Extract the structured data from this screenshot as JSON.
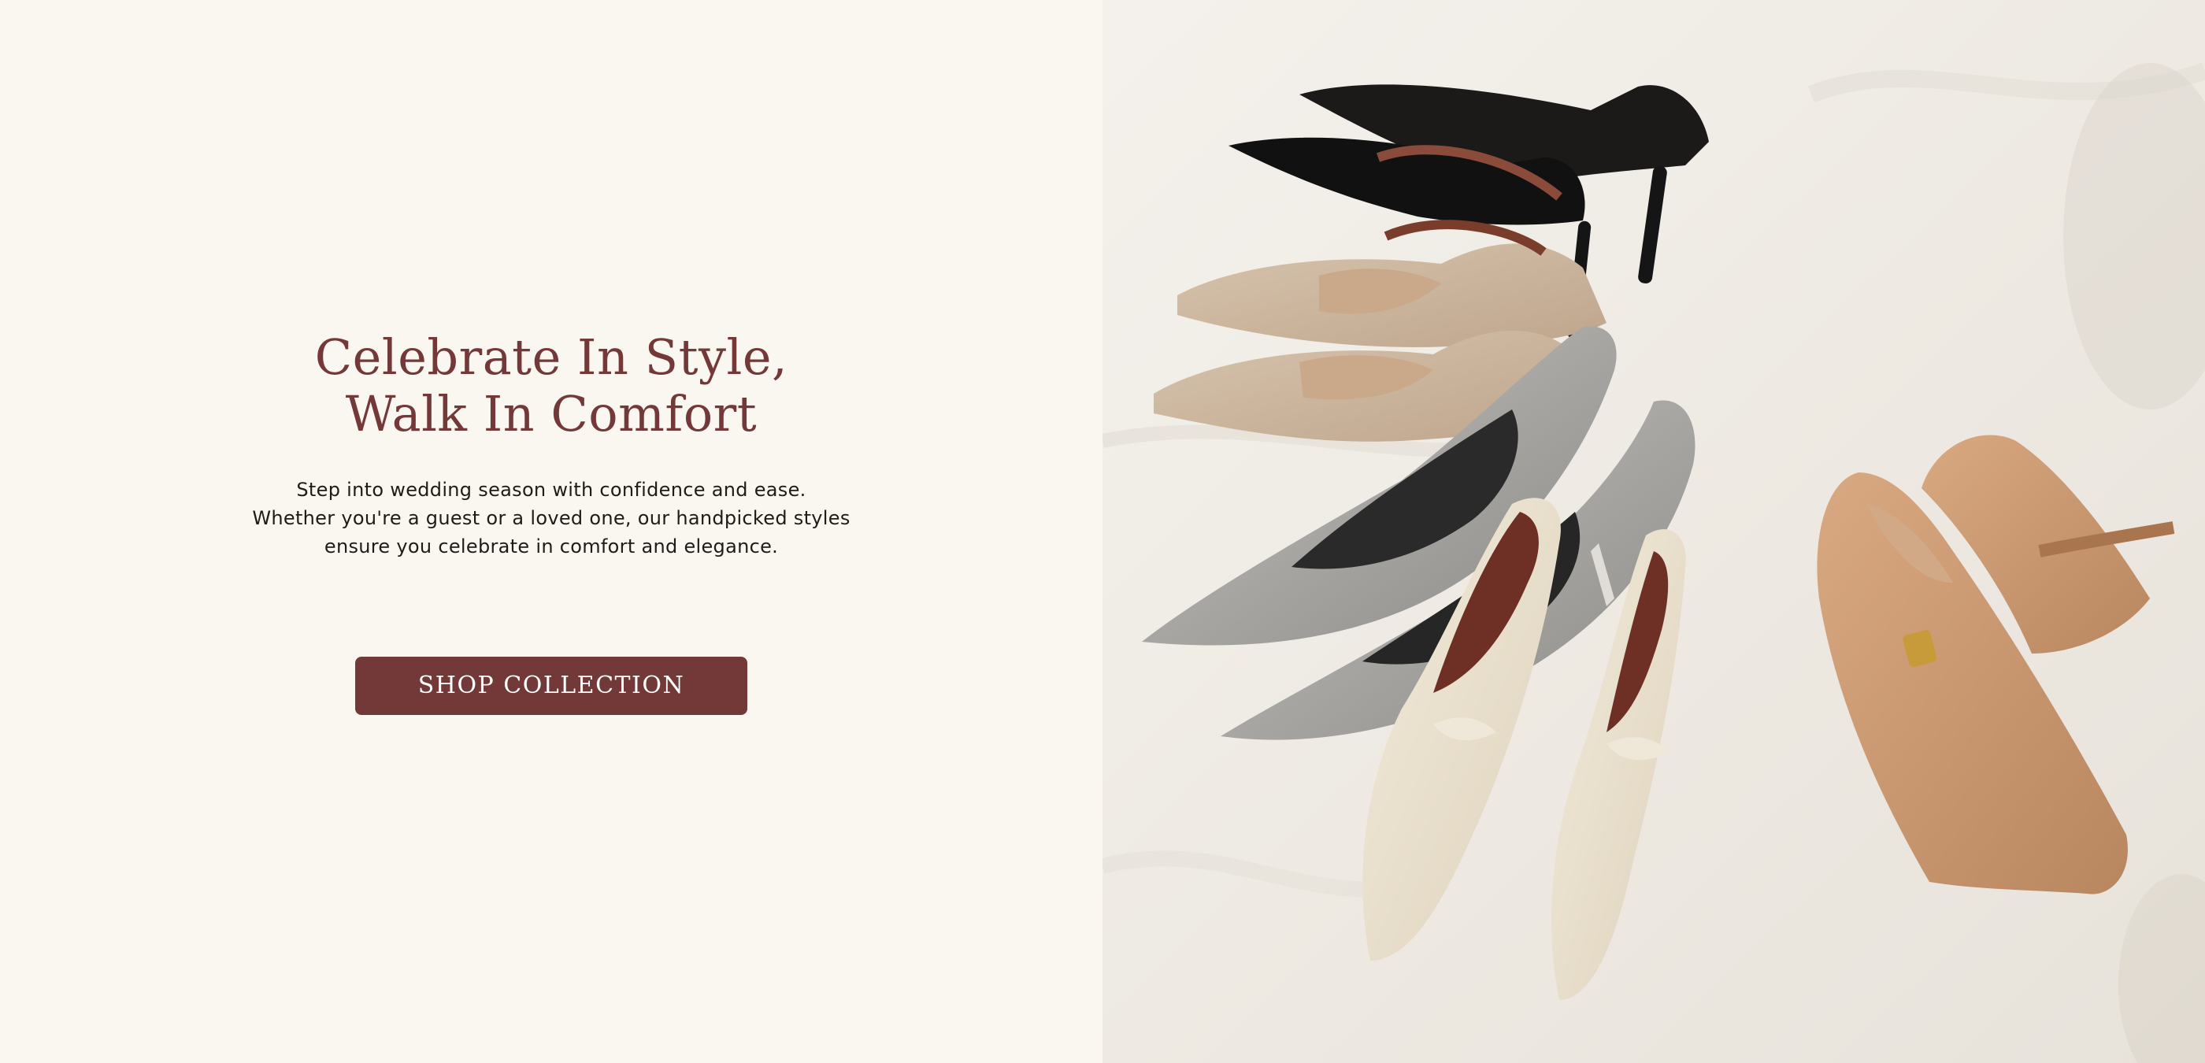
{
  "hero": {
    "title_line1": "Celebrate In Style,",
    "title_line2": "Walk In Comfort",
    "description": "Step into wedding season with confidence and ease. Whether you're a guest or a loved one, our handpicked styles ensure you celebrate in comfort and elegance.",
    "cta_label": "SHOP COLLECTION"
  },
  "colors": {
    "brand": "#733938",
    "background": "#faf7f1",
    "text": "#1f1b18"
  },
  "image": {
    "subject": "shoes-photo"
  }
}
